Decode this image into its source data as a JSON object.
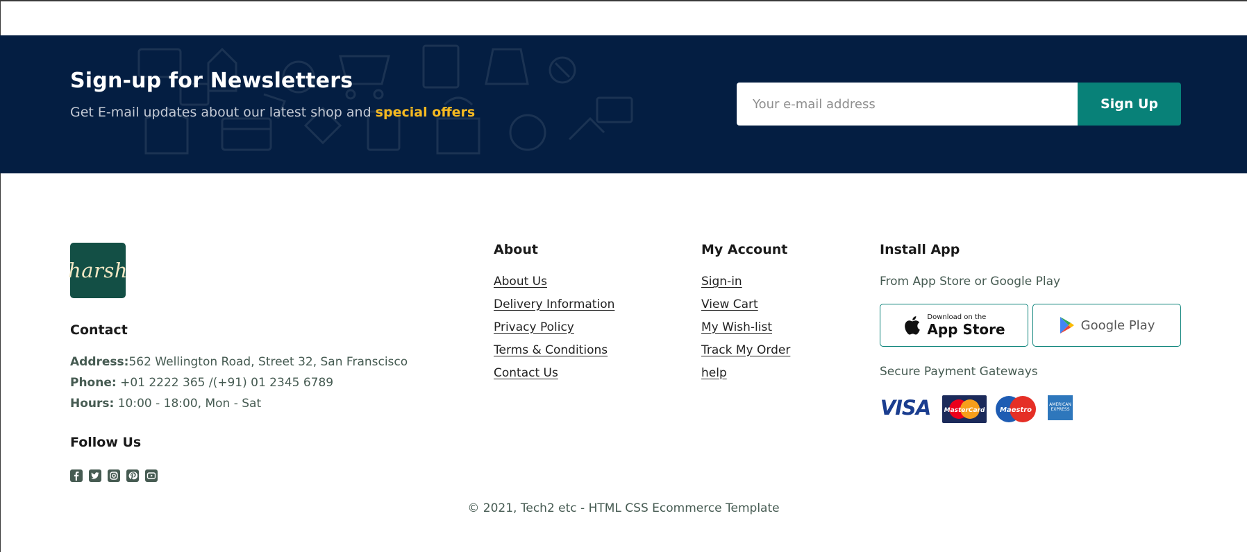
{
  "newsletter": {
    "title": "Sign-up for Newsletters",
    "subtitle": "Get E-mail updates about our latest shop and ",
    "highlight": "special offers",
    "email_placeholder": "Your e-mail address",
    "button_label": "Sign Up",
    "colors": {
      "band": "#041e42",
      "highlight": "#f5b921",
      "button": "#088178"
    }
  },
  "brand": {
    "logo_text": "harsh",
    "logo_bg": "#134f45"
  },
  "contact": {
    "heading": "Contact",
    "address_label": "Address:",
    "address_value": "562 Wellington Road, Street 32, San Franscisco",
    "phone_label": "Phone:",
    "phone_value": " +01 2222 365 /(+91) 01 2345 6789",
    "hours_label": "Hours:",
    "hours_value": " 10:00 - 18:00, Mon - Sat"
  },
  "follow": {
    "heading": "Follow Us",
    "icons": [
      "facebook-icon",
      "twitter-icon",
      "instagram-icon",
      "pinterest-icon",
      "youtube-icon"
    ]
  },
  "about": {
    "heading": "About",
    "links": [
      "About Us",
      "Delivery Information",
      "Privacy Policy",
      "Terms & Conditions",
      "Contact Us"
    ]
  },
  "account": {
    "heading": "My Account",
    "links": [
      "Sign-in",
      "View Cart",
      "My Wish-list",
      "Track My Order",
      "help"
    ]
  },
  "install": {
    "heading": "Install App",
    "subtitle": "From App Store or Google Play",
    "appstore_small": "Download on the",
    "appstore_big": "App Store",
    "googleplay": "Google Play",
    "payment_heading": "Secure Payment Gateways",
    "payments": [
      "VISA",
      "MasterCard",
      "Maestro",
      "AMERICAN EXPRESS"
    ]
  },
  "copyright": "© 2021, Tech2 etc - HTML CSS Ecommerce Template"
}
